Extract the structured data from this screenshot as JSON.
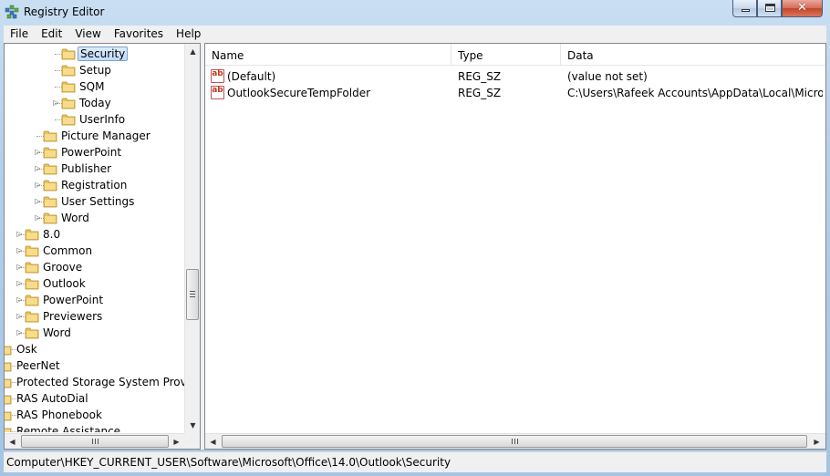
{
  "window": {
    "title": "Registry Editor",
    "close_glyph": "✕"
  },
  "menu": [
    "File",
    "Edit",
    "View",
    "Favorites",
    "Help"
  ],
  "tree": [
    {
      "label": "Security",
      "level": 3,
      "expander": "none",
      "selected": true
    },
    {
      "label": "Setup",
      "level": 3,
      "expander": "none"
    },
    {
      "label": "SQM",
      "level": 3,
      "expander": "none"
    },
    {
      "label": "Today",
      "level": 3,
      "expander": "collapsed"
    },
    {
      "label": "UserInfo",
      "level": 3,
      "expander": "none"
    },
    {
      "label": "Picture Manager",
      "level": 2,
      "expander": "none"
    },
    {
      "label": "PowerPoint",
      "level": 2,
      "expander": "collapsed"
    },
    {
      "label": "Publisher",
      "level": 2,
      "expander": "collapsed"
    },
    {
      "label": "Registration",
      "level": 2,
      "expander": "collapsed"
    },
    {
      "label": "User Settings",
      "level": 2,
      "expander": "collapsed"
    },
    {
      "label": "Word",
      "level": 2,
      "expander": "collapsed"
    },
    {
      "label": "8.0",
      "level": 1,
      "expander": "collapsed"
    },
    {
      "label": "Common",
      "level": 1,
      "expander": "collapsed"
    },
    {
      "label": "Groove",
      "level": 1,
      "expander": "collapsed"
    },
    {
      "label": "Outlook",
      "level": 1,
      "expander": "collapsed"
    },
    {
      "label": "PowerPoint",
      "level": 1,
      "expander": "collapsed"
    },
    {
      "label": "Previewers",
      "level": 1,
      "expander": "collapsed"
    },
    {
      "label": "Word",
      "level": 1,
      "expander": "collapsed"
    },
    {
      "label": "Osk",
      "level": 0,
      "expander": "none"
    },
    {
      "label": "PeerNet",
      "level": 0,
      "expander": "none"
    },
    {
      "label": "Protected Storage System Provider",
      "level": 0,
      "expander": "none"
    },
    {
      "label": "RAS AutoDial",
      "level": 0,
      "expander": "none"
    },
    {
      "label": "RAS Phonebook",
      "level": 0,
      "expander": "none"
    },
    {
      "label": "Remote Assistance",
      "level": 0,
      "expander": "none"
    }
  ],
  "list": {
    "columns": [
      "Name",
      "Type",
      "Data"
    ],
    "rows": [
      {
        "icon": "ab",
        "name": "(Default)",
        "type": "REG_SZ",
        "data": "(value not set)"
      },
      {
        "icon": "ab",
        "name": "OutlookSecureTempFolder",
        "type": "REG_SZ",
        "data": "C:\\Users\\Rafeek Accounts\\AppData\\Local\\Micros..."
      }
    ]
  },
  "scroll": {
    "up": "▲",
    "down": "▼",
    "left": "◀",
    "right": "▶"
  },
  "status": {
    "path": "Computer\\HKEY_CURRENT_USER\\Software\\Microsoft\\Office\\14.0\\Outlook\\Security"
  },
  "colors": {
    "folder": "#e8c25a",
    "selection": "#c1dbfc"
  }
}
